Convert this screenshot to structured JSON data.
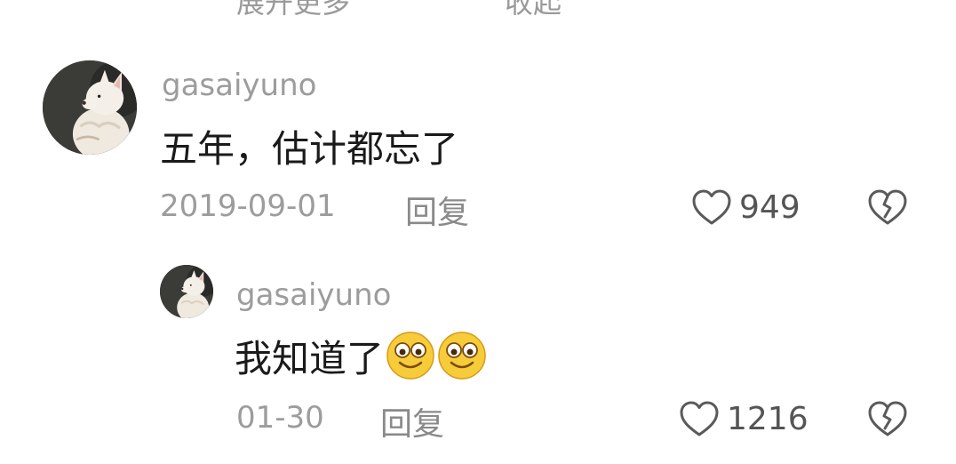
{
  "previous_comment": {
    "cut_text_left": "展开更多",
    "cut_text_right": "收起"
  },
  "comment": {
    "username": "gasaiyuno",
    "text": "五年，估计都忘了",
    "date": "2019-09-01",
    "reply_label": "回复",
    "like_count": "949",
    "icons": [
      "avatar-cat",
      "heart-icon",
      "broken-heart-icon"
    ]
  },
  "reply": {
    "username": "gasaiyuno",
    "text": "我知道了",
    "emojis": [
      "smiling-face-emoji",
      "smiling-face-emoji"
    ],
    "date": "01-30",
    "reply_label": "回复",
    "like_count": "1216",
    "icons": [
      "avatar-cat",
      "heart-icon",
      "broken-heart-icon"
    ]
  },
  "colors": {
    "background": "#ffffff",
    "username": "#9c9c9c",
    "body_text": "#1a1a1a",
    "meta_text": "#9c9c9c",
    "icon_stroke": "#5a5a5a",
    "emoji_face": "#f7cc3b"
  }
}
